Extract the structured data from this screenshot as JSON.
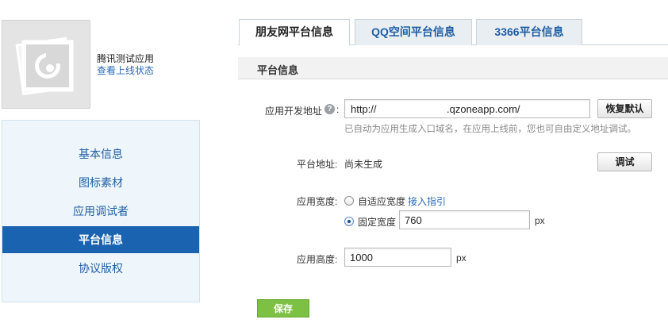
{
  "app": {
    "name": "腾讯测试应用",
    "status_link": "查看上线状态"
  },
  "sidebar": {
    "items": [
      {
        "label": "基本信息"
      },
      {
        "label": "图标素材"
      },
      {
        "label": "应用调试者"
      },
      {
        "label": "平台信息",
        "active": true
      },
      {
        "label": "协议版权"
      }
    ]
  },
  "tabs": [
    {
      "label": "朋友网平台信息",
      "active": true
    },
    {
      "label": "QQ空间平台信息"
    },
    {
      "label": "3366平台信息"
    }
  ],
  "section": {
    "title": "平台信息"
  },
  "form": {
    "dev_url_label": "应用开发地址",
    "dev_url_colon": ":",
    "dev_url_prefix": "http://",
    "dev_url_suffix": ".qzoneapp.com/",
    "restore_default": "恢复默认",
    "hint": "已自动为应用生成入口域名，在应用上线前，您也可自由定义地址调试。",
    "platform_url_label": "平台地址:",
    "platform_url_value": "尚未生成",
    "debug_button": "调试",
    "width_label": "应用宽度:",
    "width_option_auto": "自适应宽度",
    "width_guide_link": "接入指引",
    "width_option_fixed": "固定宽度",
    "width_value": "760",
    "width_unit": "px",
    "height_label": "应用高度:",
    "height_value": "1000",
    "height_unit": "px",
    "save": "保存"
  },
  "colors": {
    "active_nav": "#1a63b0",
    "link": "#2a6ab6",
    "save_green": "#7cc044"
  }
}
